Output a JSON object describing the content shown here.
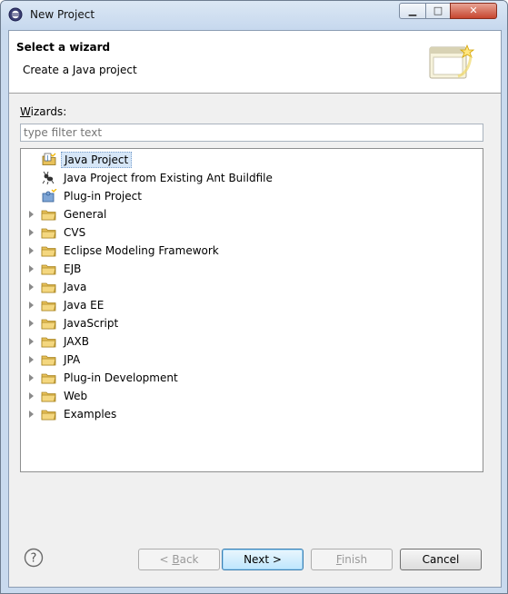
{
  "window": {
    "title": "New Project"
  },
  "header": {
    "title": "Select a wizard",
    "description": "Create a Java project"
  },
  "wizards_label": {
    "mnemonic": "W",
    "rest": "izards:"
  },
  "filter": {
    "placeholder": "type filter text"
  },
  "tree": {
    "items": [
      {
        "label": "Java Project",
        "icon": "java-project-icon",
        "expandable": false,
        "selected": true
      },
      {
        "label": "Java Project from Existing Ant Buildfile",
        "icon": "ant-icon",
        "expandable": false,
        "selected": false
      },
      {
        "label": "Plug-in Project",
        "icon": "plugin-project-icon",
        "expandable": false,
        "selected": false
      },
      {
        "label": "General",
        "icon": "folder-icon",
        "expandable": true,
        "selected": false
      },
      {
        "label": "CVS",
        "icon": "folder-icon",
        "expandable": true,
        "selected": false
      },
      {
        "label": "Eclipse Modeling Framework",
        "icon": "folder-icon",
        "expandable": true,
        "selected": false
      },
      {
        "label": "EJB",
        "icon": "folder-icon",
        "expandable": true,
        "selected": false
      },
      {
        "label": "Java",
        "icon": "folder-icon",
        "expandable": true,
        "selected": false
      },
      {
        "label": "Java EE",
        "icon": "folder-icon",
        "expandable": true,
        "selected": false
      },
      {
        "label": "JavaScript",
        "icon": "folder-icon",
        "expandable": true,
        "selected": false
      },
      {
        "label": "JAXB",
        "icon": "folder-icon",
        "expandable": true,
        "selected": false
      },
      {
        "label": "JPA",
        "icon": "folder-icon",
        "expandable": true,
        "selected": false
      },
      {
        "label": "Plug-in Development",
        "icon": "folder-icon",
        "expandable": true,
        "selected": false
      },
      {
        "label": "Web",
        "icon": "folder-icon",
        "expandable": true,
        "selected": false
      },
      {
        "label": "Examples",
        "icon": "folder-icon",
        "expandable": true,
        "selected": false
      }
    ]
  },
  "buttons": {
    "back": {
      "prefix": "< ",
      "mnemonic": "B",
      "rest": "ack",
      "enabled": false
    },
    "next": {
      "label": "Next >",
      "enabled": true
    },
    "finish": {
      "mnemonic": "F",
      "rest": "inish",
      "enabled": false
    },
    "cancel": {
      "label": "Cancel",
      "enabled": true
    }
  },
  "colors": {
    "selection": "#d6e6f7",
    "folder": "#e8c15a",
    "titlebar": "#c6d8ee"
  }
}
